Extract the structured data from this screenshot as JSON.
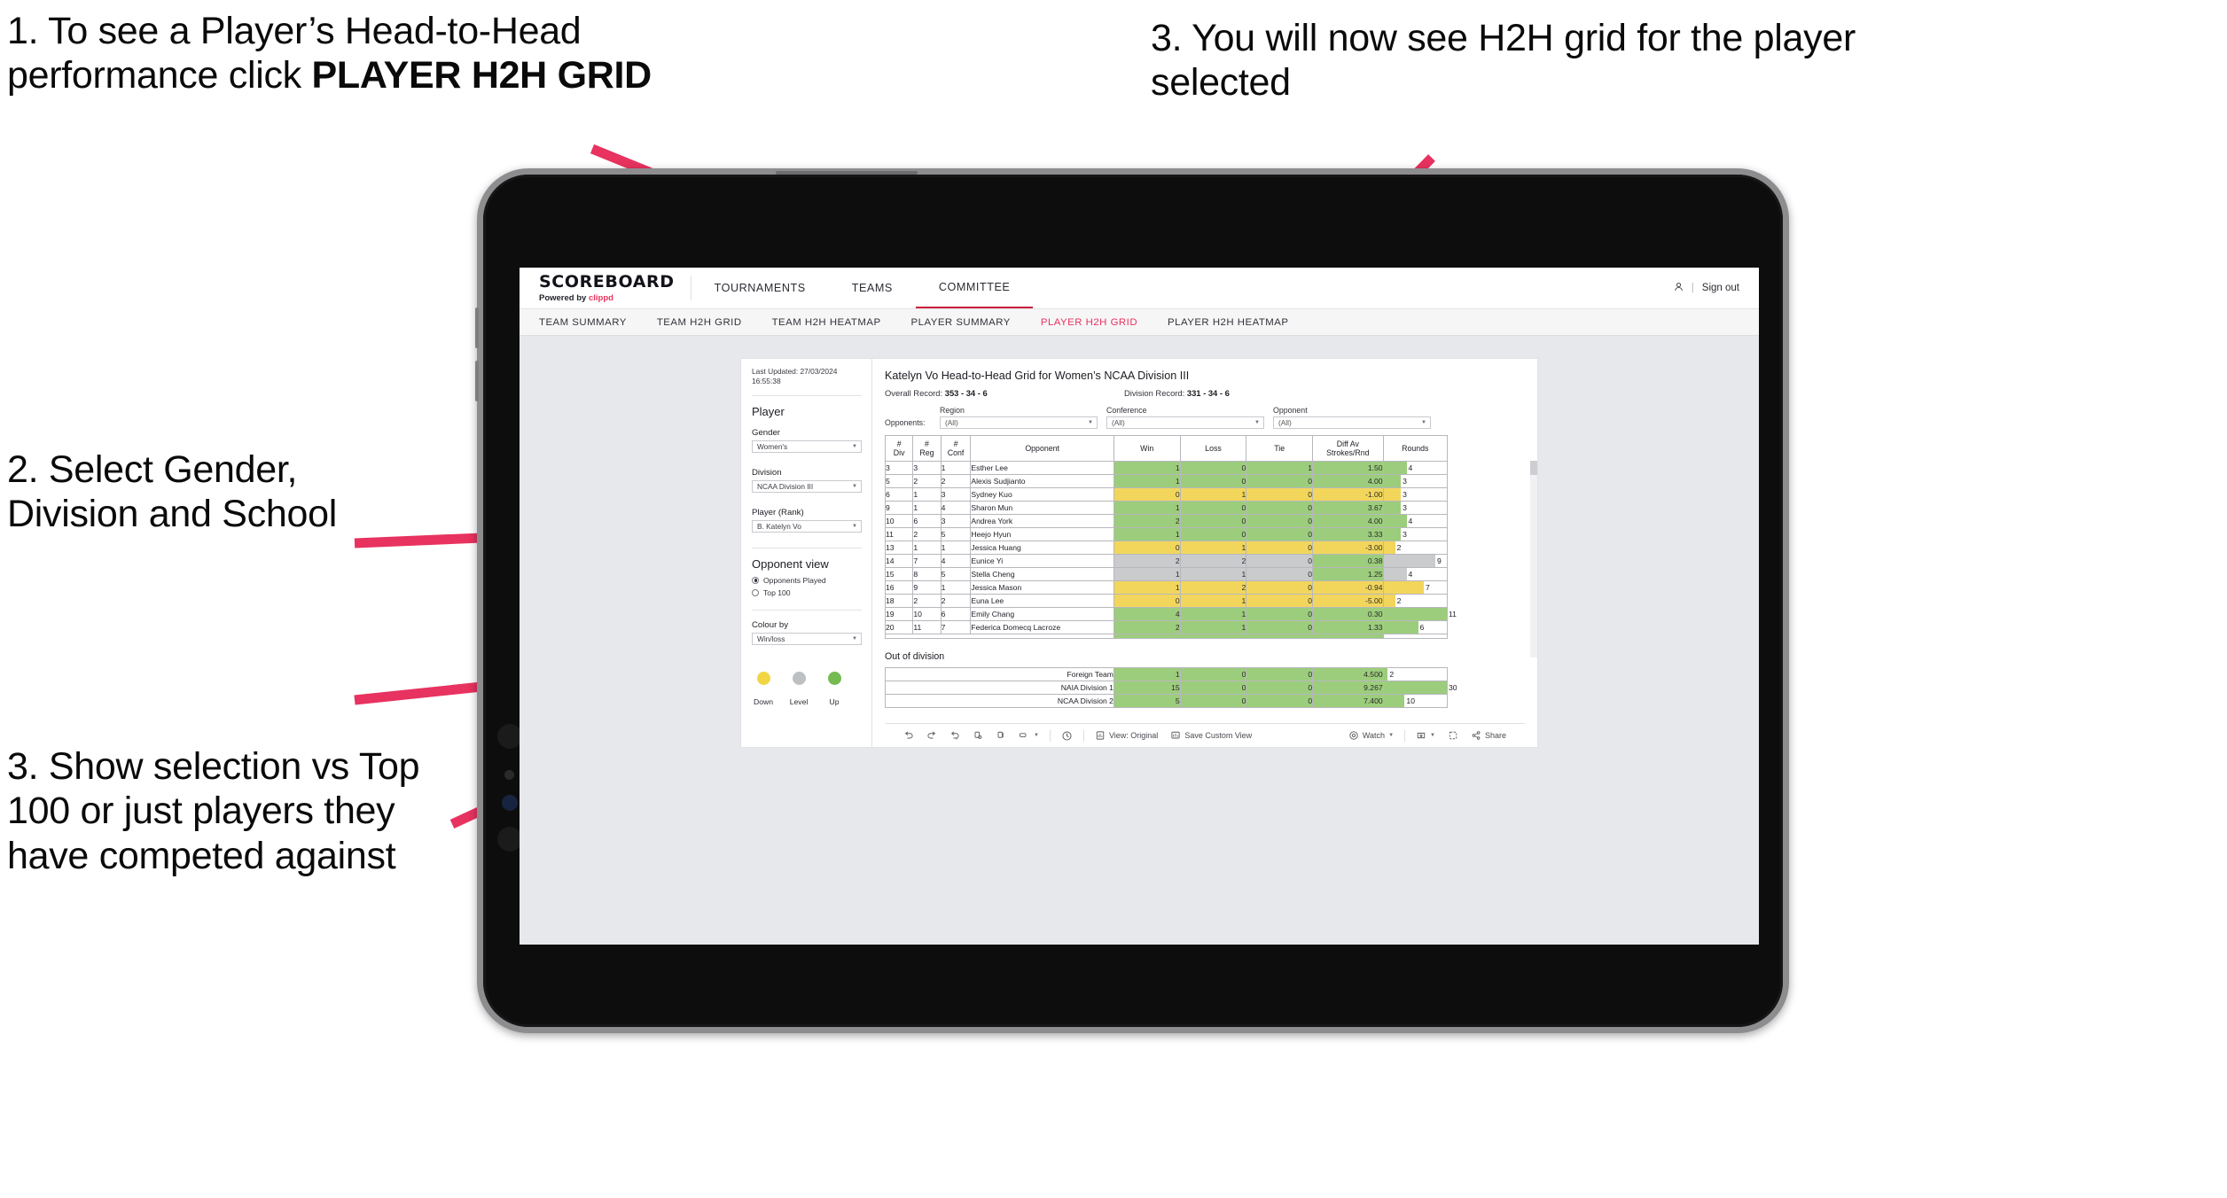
{
  "annotations": {
    "a1_part1": "1. To see a Player’s Head-to-Head performance click ",
    "a1_bold": "PLAYER H2H GRID",
    "a2": "2. Select Gender, Division and School",
    "a3": "3. Show selection vs Top 100 or just players they have competed against",
    "a4": "3. You will now see H2H grid for the player selected",
    "arrow_color": "#e8325f"
  },
  "app": {
    "brand_title": "SCOREBOARD",
    "brand_sub_prefix": "Powered by ",
    "brand_sub_accent": "clippd",
    "top_nav": [
      "TOURNAMENTS",
      "TEAMS",
      "COMMITTEE"
    ],
    "top_nav_active": "COMMITTEE",
    "account_glyph": "",
    "separator": "|",
    "sign_out": "Sign out",
    "sub_nav": [
      "TEAM SUMMARY",
      "TEAM H2H GRID",
      "TEAM H2H HEATMAP",
      "PLAYER SUMMARY",
      "PLAYER H2H GRID",
      "PLAYER H2H HEATMAP"
    ],
    "sub_nav_active": "PLAYER H2H GRID",
    "accent_color": "#e8325f"
  },
  "panel": {
    "last_updated": "Last Updated: 27/03/2024 16:55:38",
    "heading": "Player",
    "gender_label": "Gender",
    "gender_value": "Women's",
    "division_label": "Division",
    "division_value": "NCAA Division III",
    "player_label": "Player (Rank)",
    "player_value": "B. Katelyn Vo",
    "opponent_view_heading": "Opponent view",
    "radio_opponents_played": "Opponents Played",
    "radio_top100": "Top 100",
    "radio_selected": "Opponents Played",
    "colour_by_label": "Colour by",
    "colour_by_value": "Win/loss",
    "legend": [
      {
        "label": "Down",
        "color": "#f2d543"
      },
      {
        "label": "Level",
        "color": "#bdc0c2"
      },
      {
        "label": "Up",
        "color": "#76bb52"
      }
    ]
  },
  "main": {
    "title": "Katelyn Vo Head-to-Head Grid for Women’s NCAA Division III",
    "overall_record_label": "Overall Record: ",
    "overall_record_value": "353 -  34 - 6",
    "division_record_label": "Division Record: ",
    "division_record_value": "331 -  34 - 6",
    "opponents_label": "Opponents:",
    "filters": [
      {
        "label": "Region",
        "value": "(All)"
      },
      {
        "label": "Conference",
        "value": "(All)"
      },
      {
        "label": "Opponent",
        "value": "(All)"
      }
    ]
  },
  "chart_data": {
    "type": "table",
    "title": "Katelyn Vo Head-to-Head Grid for Women’s NCAA Division III",
    "columns": [
      "# Div",
      "# Reg",
      "# Conf",
      "Opponent",
      "Win",
      "Loss",
      "Tie",
      "Diff Av Strokes/Rnd",
      "Rounds"
    ],
    "column_headers_two_line": [
      [
        "#",
        "Div"
      ],
      [
        "#",
        "Reg"
      ],
      [
        "#",
        "Conf"
      ],
      [
        "Opponent",
        ""
      ],
      [
        "Win",
        ""
      ],
      [
        "Loss",
        ""
      ],
      [
        "Tie",
        ""
      ],
      [
        "Diff Av",
        "Strokes/Rnd"
      ],
      [
        "Rounds",
        ""
      ]
    ],
    "rounds_max": 11,
    "rows": [
      {
        "div": "3",
        "reg": "3",
        "conf": "1",
        "opponent": "Esther Lee",
        "win": "1",
        "loss": "0",
        "tie": "1",
        "diff": "1.50",
        "rounds": "4",
        "color": "#9ccd7c"
      },
      {
        "div": "5",
        "reg": "2",
        "conf": "2",
        "opponent": "Alexis Sudjianto",
        "win": "1",
        "loss": "0",
        "tie": "0",
        "diff": "4.00",
        "rounds": "3",
        "color": "#9ccd7c"
      },
      {
        "div": "6",
        "reg": "1",
        "conf": "3",
        "opponent": "Sydney Kuo",
        "win": "0",
        "loss": "1",
        "tie": "0",
        "diff": "-1.00",
        "rounds": "3",
        "color": "#f2d65c"
      },
      {
        "div": "9",
        "reg": "1",
        "conf": "4",
        "opponent": "Sharon Mun",
        "win": "1",
        "loss": "0",
        "tie": "0",
        "diff": "3.67",
        "rounds": "3",
        "color": "#9ccd7c"
      },
      {
        "div": "10",
        "reg": "6",
        "conf": "3",
        "opponent": "Andrea York",
        "win": "2",
        "loss": "0",
        "tie": "0",
        "diff": "4.00",
        "rounds": "4",
        "color": "#9ccd7c"
      },
      {
        "div": "11",
        "reg": "2",
        "conf": "5",
        "opponent": "Heejo Hyun",
        "win": "1",
        "loss": "0",
        "tie": "0",
        "diff": "3.33",
        "rounds": "3",
        "color": "#9ccd7c"
      },
      {
        "div": "13",
        "reg": "1",
        "conf": "1",
        "opponent": "Jessica Huang",
        "win": "0",
        "loss": "1",
        "tie": "0",
        "diff": "-3.00",
        "rounds": "2",
        "color": "#f2d65c"
      },
      {
        "div": "14",
        "reg": "7",
        "conf": "4",
        "opponent": "Eunice Yi",
        "win": "2",
        "loss": "2",
        "tie": "0",
        "diff": "0.38",
        "rounds": "9",
        "color": "#c9cbcd",
        "diff_color": "#9ccd7c"
      },
      {
        "div": "15",
        "reg": "8",
        "conf": "5",
        "opponent": "Stella Cheng",
        "win": "1",
        "loss": "1",
        "tie": "0",
        "diff": "1.25",
        "rounds": "4",
        "color": "#c9cbcd",
        "diff_color": "#9ccd7c"
      },
      {
        "div": "16",
        "reg": "9",
        "conf": "1",
        "opponent": "Jessica Mason",
        "win": "1",
        "loss": "2",
        "tie": "0",
        "diff": "-0.94",
        "rounds": "7",
        "color": "#f2d65c"
      },
      {
        "div": "18",
        "reg": "2",
        "conf": "2",
        "opponent": "Euna Lee",
        "win": "0",
        "loss": "1",
        "tie": "0",
        "diff": "-5.00",
        "rounds": "2",
        "color": "#f2d65c"
      },
      {
        "div": "19",
        "reg": "10",
        "conf": "6",
        "opponent": "Emily Chang",
        "win": "4",
        "loss": "1",
        "tie": "0",
        "diff": "0.30",
        "rounds": "11",
        "color": "#9ccd7c"
      },
      {
        "div": "20",
        "reg": "11",
        "conf": "7",
        "opponent": "Federica Domecq Lacroze",
        "win": "2",
        "loss": "1",
        "tie": "0",
        "diff": "1.33",
        "rounds": "6",
        "color": "#9ccd7c"
      }
    ],
    "out_of_division_title": "Out of division",
    "out_of_division_max": 30,
    "out_of_division": [
      {
        "name": "Foreign Team",
        "win": "1",
        "loss": "0",
        "tie": "0",
        "diff": "4.500",
        "rounds": "2",
        "color": "#9ccd7c"
      },
      {
        "name": "NAIA Division 1",
        "win": "15",
        "loss": "0",
        "tie": "0",
        "diff": "9.267",
        "rounds": "30",
        "color": "#9ccd7c"
      },
      {
        "name": "NCAA Division 2",
        "win": "5",
        "loss": "0",
        "tie": "0",
        "diff": "7.400",
        "rounds": "10",
        "color": "#9ccd7c"
      }
    ]
  },
  "toolbar": {
    "view_label": "View: Original",
    "save_label": "Save Custom View",
    "watch_label": "Watch",
    "share_label": "Share"
  }
}
